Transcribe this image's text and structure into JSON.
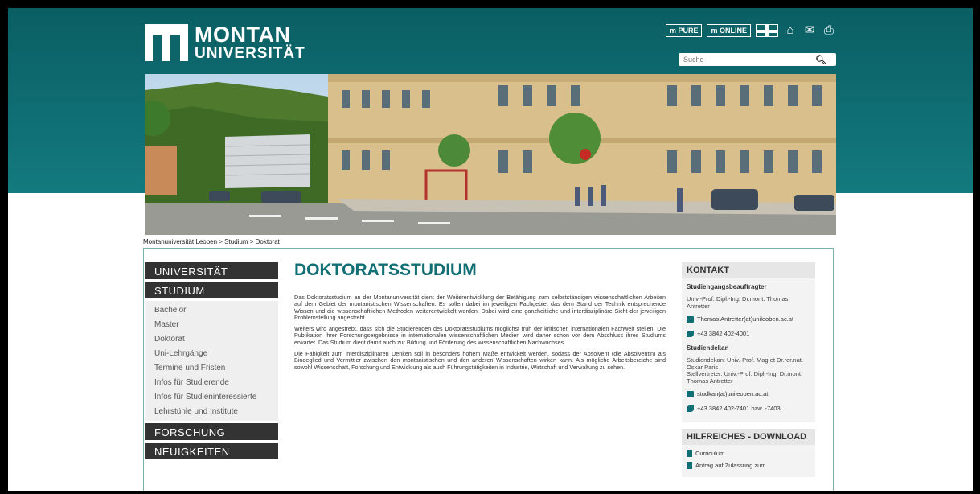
{
  "logo": {
    "line1": "MONTAN",
    "line2": "UNIVERSITÄT"
  },
  "top_links": {
    "mupure": "PURE",
    "muonline": "ONLINE"
  },
  "icons": [
    "uk-flag-icon",
    "home-icon",
    "mail-icon",
    "print-icon",
    "search-icon"
  ],
  "search": {
    "placeholder": "Suche"
  },
  "breadcrumb": "Montanuniversität Leoben > Studium > Doktorat",
  "sidebar": {
    "universitaet": "UNIVERSITÄT",
    "studium": "STUDIUM",
    "items": [
      "Bachelor",
      "Master",
      "Doktorat",
      "Uni-Lehrgänge",
      "Termine und Fristen",
      "Infos für Studierende",
      "Infos für Studieninteressierte",
      "Lehrstühle und Institute"
    ],
    "forschung": "FORSCHUNG",
    "neuigkeiten": "NEUIGKEITEN"
  },
  "main": {
    "title": "DOKTORATSSTUDIUM",
    "p1": "Das Doktoratsstudium an der Montanuniversität dient der Weiterentwicklung der Befähigung zum selbstständigen wissenschaftlichen Arbeiten auf dem Gebiet der montanistischen Wissenschaften. Es sollen dabei im jeweiligen Fachgebiet das dem Stand der Technik entsprechende Wissen und die wissenschaftlichen Methoden weiterentwickelt werden. Dabei wird eine ganzheitliche und interdisziplinäre Sicht der jeweiligen Problemstellung angestrebt.",
    "p2": "Weiters wird angestrebt, dass sich die Studierenden des Doktoratsstudiums möglichst früh der kritischen internationalen Fachwelt stellen. Die Publikation ihrer Forschungsergebnisse in internationalen wissenschaftlichen Medien wird daher schon vor dem Abschluss ihres Studiums erwartet. Das Studium dient damit auch zur Bildung und Förderung des wissenschaftlichen Nachwuchses.",
    "p3": "Die Fähigkeit zum interdisziplinären Denken soll in besonders hohem Maße entwickelt werden, sodass der Absolvent (die Absolventin) als Bindeglied und Vermittler zwischen den montanistischen und den anderen Wissenschaften wirken kann. Als mögliche Arbeitsbereiche sind sowohl Wissenschaft, Forschung und Entwicklung als auch Führungstätigkeiten in Industrie, Wirtschaft und Verwaltung zu sehen."
  },
  "kontakt": {
    "title": "KONTAKT",
    "sub1": "Studiengangsbeauftragter",
    "person1": "Univ.-Prof. Dipl.-Ing. Dr.mont. Thomas Antretter",
    "email1": "Thomas.Antretter(at)unileoben.ac.at",
    "phone1": "+43 3842 402-4001",
    "sub2": "Studiendekan",
    "person2a": "Studiendekan: Univ.-Prof. Mag.et Dr.rer.nat. Oskar Paris",
    "person2b": "Stellvertreter: Univ.-Prof. Dipl.-Ing. Dr.mont. Thomas Antretter",
    "email2": "studkan(at)unileoben.ac.at",
    "phone2": "+43 3842 402-7401 bzw. -7403"
  },
  "download": {
    "title": "HILFREICHES - DOWNLOAD",
    "items": [
      "Curriculum",
      "Antrag auf Zulassung zum"
    ]
  }
}
